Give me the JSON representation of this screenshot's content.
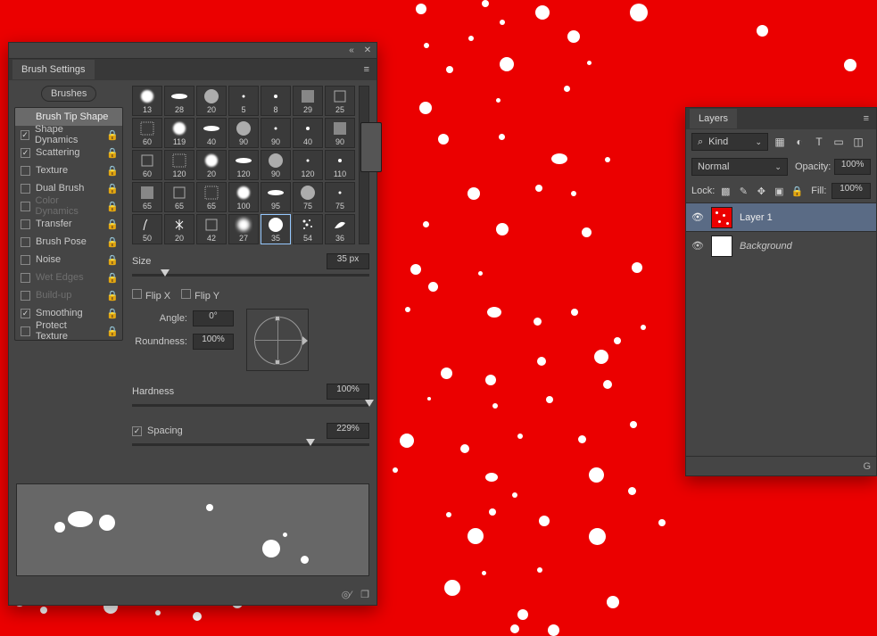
{
  "brush_panel": {
    "title": "Brush Settings",
    "brushes_btn": "Brushes",
    "options": [
      {
        "label": "Brush Tip Shape",
        "checkable": false,
        "checked": false,
        "disabled": false,
        "lock": false,
        "selected": true
      },
      {
        "label": "Shape Dynamics",
        "checkable": true,
        "checked": true,
        "disabled": false,
        "lock": true,
        "selected": false
      },
      {
        "label": "Scattering",
        "checkable": true,
        "checked": true,
        "disabled": false,
        "lock": true,
        "selected": false
      },
      {
        "label": "Texture",
        "checkable": true,
        "checked": false,
        "disabled": false,
        "lock": true,
        "selected": false
      },
      {
        "label": "Dual Brush",
        "checkable": true,
        "checked": false,
        "disabled": false,
        "lock": true,
        "selected": false
      },
      {
        "label": "Color Dynamics",
        "checkable": true,
        "checked": false,
        "disabled": true,
        "lock": true,
        "selected": false
      },
      {
        "label": "Transfer",
        "checkable": true,
        "checked": false,
        "disabled": false,
        "lock": true,
        "selected": false
      },
      {
        "label": "Brush Pose",
        "checkable": true,
        "checked": false,
        "disabled": false,
        "lock": true,
        "selected": false
      },
      {
        "label": "Noise",
        "checkable": true,
        "checked": false,
        "disabled": false,
        "lock": true,
        "selected": false
      },
      {
        "label": "Wet Edges",
        "checkable": true,
        "checked": false,
        "disabled": true,
        "lock": true,
        "selected": false
      },
      {
        "label": "Build-up",
        "checkable": true,
        "checked": false,
        "disabled": true,
        "lock": true,
        "selected": false
      },
      {
        "label": "Smoothing",
        "checkable": true,
        "checked": true,
        "disabled": false,
        "lock": true,
        "selected": false
      },
      {
        "label": "Protect Texture",
        "checkable": true,
        "checked": false,
        "disabled": false,
        "lock": true,
        "selected": false
      }
    ],
    "tips": [
      13,
      28,
      20,
      5,
      8,
      29,
      25,
      60,
      119,
      40,
      90,
      90,
      40,
      90,
      60,
      120,
      20,
      120,
      90,
      120,
      110,
      65,
      65,
      65,
      100,
      95,
      75,
      75,
      50,
      20,
      42,
      27,
      35,
      54,
      36
    ],
    "selected_tip_index": 32,
    "size_label": "Size",
    "size_value": "35 px",
    "flip_x": "Flip X",
    "flip_y": "Flip Y",
    "angle_label": "Angle:",
    "angle_value": "0°",
    "roundness_label": "Roundness:",
    "roundness_value": "100%",
    "hardness_label": "Hardness",
    "hardness_value": "100%",
    "spacing_label": "Spacing",
    "spacing_checked": true,
    "spacing_value": "229%"
  },
  "layers_panel": {
    "title": "Layers",
    "kind_label": "Kind",
    "blend_mode": "Normal",
    "opacity_label": "Opacity:",
    "opacity_value": "100%",
    "lock_label": "Lock:",
    "fill_label": "Fill:",
    "fill_value": "100%",
    "layers": [
      {
        "name": "Layer 1",
        "selected": true,
        "thumb": "red"
      },
      {
        "name": "Background",
        "selected": false,
        "thumb": "white",
        "italic": true
      }
    ],
    "footer_hint": "G"
  }
}
